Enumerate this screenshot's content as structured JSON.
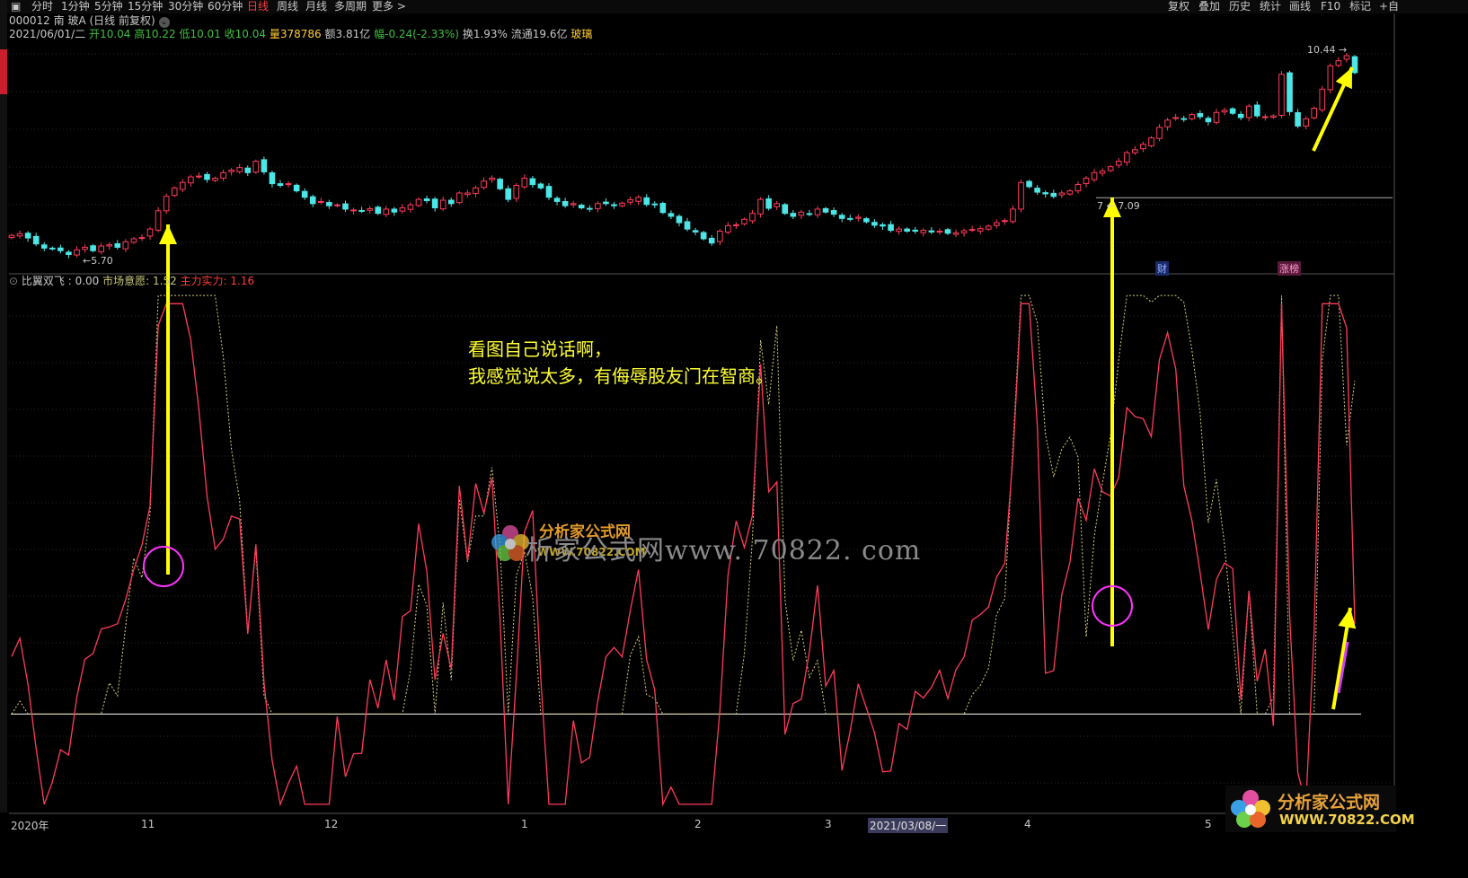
{
  "toolbar": {
    "left": [
      "分时",
      "1分钟",
      "5分钟",
      "15分钟",
      "30分钟",
      "60分钟",
      "日线",
      "周线",
      "月线",
      "多周期",
      "更多"
    ],
    "active": "日线",
    "right": [
      "复权",
      "叠加",
      "历史",
      "统计",
      "画线",
      "F10",
      "标记",
      "+自"
    ]
  },
  "stock": {
    "code_name": "000012 南 玻A",
    "mode": "(日线 前复权)",
    "date": "2021/06/01/二",
    "open_label": "开",
    "open": "10.04",
    "high_label": "高",
    "high": "10.22",
    "low_label": "低",
    "low": "10.01",
    "close_label": "收",
    "close": "10.04",
    "volume_label": "量",
    "volume": "378786",
    "amount_label": "额",
    "amount": "3.81亿",
    "change_label": "幅",
    "change": "-0.24(-2.33%)",
    "turnover_label": "换",
    "turnover": "1.93%",
    "float_label": "流通",
    "float": "19.6亿",
    "sector": "玻璃"
  },
  "indicator": {
    "name": "比翼双飞",
    "value": ": 0.00",
    "s1_label": "市场意愿: ",
    "s1_value": "1.52",
    "s2_label": "主力实力: ",
    "s2_value": "1.16"
  },
  "annotation": {
    "line1": "看图自己说话啊，",
    "line2": "我感觉说太多，有侮辱股友门在智商。"
  },
  "watermark": {
    "site_text": "析家公式网www. 70822. com",
    "logo_title": "分析家公式网",
    "logo_url": "WWW.70822.COM"
  },
  "price_marks": {
    "low_mark": "5.70",
    "mid_mark": "7.09",
    "mid_prefix": "7",
    "high_mark": "10.44"
  },
  "tags": {
    "cai": "财",
    "zhangting": "涨榜"
  },
  "x_axis": [
    {
      "label": "2020年",
      "highlight": false
    },
    {
      "label": "11",
      "highlight": false
    },
    {
      "label": "12",
      "highlight": false
    },
    {
      "label": "1",
      "highlight": false
    },
    {
      "label": "2",
      "highlight": false
    },
    {
      "label": "3",
      "highlight": false
    },
    {
      "label": "2021/03/08/一",
      "highlight": true
    },
    {
      "label": "4",
      "highlight": false
    },
    {
      "label": "5",
      "highlight": false
    }
  ],
  "colors": {
    "up": "#ff3b5c",
    "down": "#4de6e6",
    "force_line": "#ff3b5c",
    "will_line": "#d8d07a",
    "arrow": "#ffff00",
    "circle": "#ff33ff",
    "zero_line": "#ffffff"
  },
  "chart_data": [
    {
      "type": "candlestick",
      "title": "000012 南 玻A (日线 前复权)",
      "y_range": [
        5.4,
        10.8
      ],
      "closes": [
        6.2,
        6.24,
        6.14,
        6.0,
        5.9,
        5.88,
        5.84,
        5.75,
        5.86,
        5.92,
        5.84,
        5.95,
        5.98,
        5.92,
        6.05,
        6.12,
        6.15,
        6.35,
        6.78,
        7.12,
        7.32,
        7.45,
        7.58,
        7.6,
        7.52,
        7.55,
        7.68,
        7.74,
        7.8,
        7.68,
        7.95,
        7.7,
        7.42,
        7.38,
        7.42,
        7.25,
        7.1,
        6.95,
        7.0,
        6.9,
        6.92,
        6.82,
        6.8,
        6.78,
        6.83,
        6.72,
        6.82,
        6.75,
        6.85,
        6.92,
        7.05,
        7.02,
        6.85,
        7.03,
        6.95,
        7.2,
        7.2,
        7.32,
        7.48,
        7.55,
        7.3,
        7.05,
        7.38,
        7.55,
        7.4,
        7.32,
        7.1,
        7.0,
        6.9,
        6.95,
        6.85,
        6.82,
        6.95,
        6.95,
        6.9,
        6.96,
        7.04,
        7.1,
        6.93,
        6.92,
        6.74,
        6.65,
        6.5,
        6.35,
        6.28,
        6.12,
        6.02,
        6.3,
        6.43,
        6.45,
        6.58,
        6.72,
        7.05,
        6.84,
        6.95,
        6.72,
        6.65,
        6.75,
        6.7,
        6.82,
        6.75,
        6.7,
        6.6,
        6.58,
        6.63,
        6.52,
        6.44,
        6.42,
        6.32,
        6.35,
        6.3,
        6.3,
        6.32,
        6.28,
        6.3,
        6.25,
        6.26,
        6.31,
        6.34,
        6.36,
        6.42,
        6.5,
        6.55,
        6.82,
        7.45,
        7.35,
        7.22,
        7.18,
        7.12,
        7.2,
        7.25,
        7.4,
        7.55,
        7.68,
        7.72,
        7.82,
        7.95,
        8.15,
        8.22,
        8.35,
        8.5,
        8.75,
        8.92,
        8.98,
        8.95,
        9.05,
        9.0,
        8.88,
        9.1,
        9.15,
        9.08,
        8.98,
        9.25,
        9.02,
        9.0,
        9.02,
        10.0,
        9.12,
        8.78,
        8.95,
        9.2,
        9.65,
        10.2,
        10.32,
        10.44,
        10.04
      ],
      "low_label": "5.70",
      "mid_label": "7.09",
      "high_label": "10.44"
    },
    {
      "type": "line",
      "title": "比翼双飞",
      "y_range": [
        -0.6,
        2.6
      ],
      "series": [
        {
          "name": "市场意愿"
        },
        {
          "name": "主力实力"
        }
      ]
    }
  ]
}
